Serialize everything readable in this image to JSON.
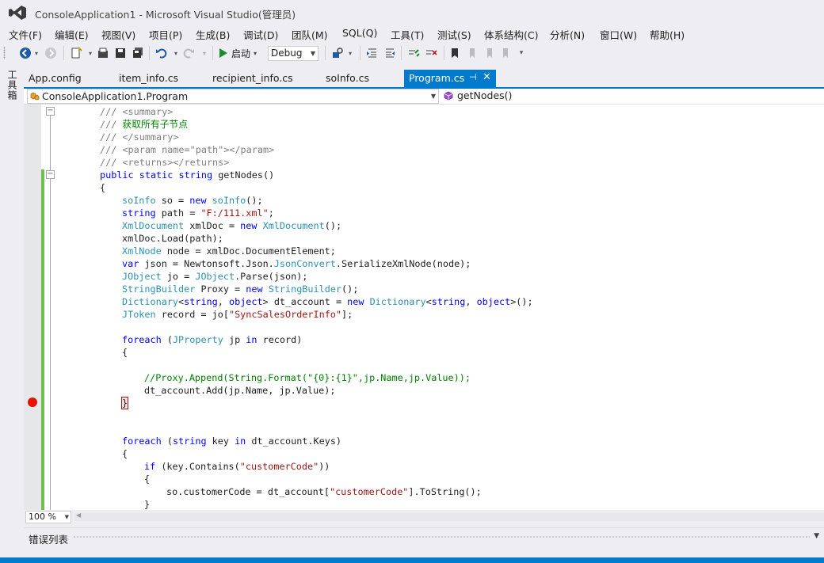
{
  "window": {
    "title": "ConsoleApplication1 - Microsoft Visual Studio(管理员)"
  },
  "menu": [
    {
      "label": "文件(F)",
      "name": "menu-file"
    },
    {
      "label": "编辑(E)",
      "name": "menu-edit"
    },
    {
      "label": "视图(V)",
      "name": "menu-view"
    },
    {
      "label": "项目(P)",
      "name": "menu-project"
    },
    {
      "label": "生成(B)",
      "name": "menu-build"
    },
    {
      "label": "调试(D)",
      "name": "menu-debug"
    },
    {
      "label": "团队(M)",
      "name": "menu-team"
    },
    {
      "label": "SQL(Q)",
      "name": "menu-sql"
    },
    {
      "label": "工具(T)",
      "name": "menu-tools"
    },
    {
      "label": "测试(S)",
      "name": "menu-test"
    },
    {
      "label": "体系结构(C)",
      "name": "menu-architecture"
    },
    {
      "label": "分析(N)",
      "name": "menu-analyze"
    },
    {
      "label": "窗口(W)",
      "name": "menu-window"
    },
    {
      "label": "帮助(H)",
      "name": "menu-help"
    }
  ],
  "toolbar": {
    "start_label": "启动",
    "config_value": "Debug"
  },
  "toolbox": {
    "label": "工具箱"
  },
  "tabs": [
    {
      "label": "App.config",
      "active": false
    },
    {
      "label": "item_info.cs",
      "active": false
    },
    {
      "label": "recipient_info.cs",
      "active": false
    },
    {
      "label": "soInfo.cs",
      "active": false
    },
    {
      "label": "Program.cs",
      "active": true
    }
  ],
  "navbar": {
    "class_value": "ConsoleApplication1.Program",
    "member_value": "getNodes()"
  },
  "code_lines": [
    "/// <summary>",
    "/// 获取所有子节点",
    "/// </summary>",
    "/// <param name=\"path\"></param>",
    "/// <returns></returns>",
    "public static string getNodes()",
    "{",
    "soInfo so = new soInfo();",
    "string path = \"F:/111.xml\";",
    "XmlDocument xmlDoc = new XmlDocument();",
    "xmlDoc.Load(path);",
    "XmlNode node = xmlDoc.DocumentElement;",
    "var json = Newtonsoft.Json.JsonConvert.SerializeXmlNode(node);",
    "JObject jo = JObject.Parse(json);",
    "StringBuilder Proxy = new StringBuilder();",
    "Dictionary<string, object> dt_account = new Dictionary<string, object>();",
    "JToken record = jo[\"SyncSalesOrderInfo\"];",
    "",
    "foreach (JProperty jp in record)",
    "{",
    "",
    "//Proxy.Append(String.Format(\"{0}:{1}\",jp.Name,jp.Value));",
    "dt_account.Add(jp.Name, jp.Value);",
    "}",
    "",
    "",
    "foreach (string key in dt_account.Keys)",
    "{",
    "if (key.Contains(\"customerCode\"))",
    "{",
    "so.customerCode = dt_account[\"customerCode\"].ToString();",
    "}"
  ],
  "status": {
    "zoom": "100 %"
  },
  "error_list": {
    "title": "错误列表"
  },
  "colors": {
    "accent": "#007acc",
    "keyword": "#0000ff",
    "type": "#2b91af",
    "string": "#a31515",
    "comment": "#008000",
    "doc_comment": "#808080",
    "breakpoint": "#e51400",
    "change_bar": "#6cc24a"
  }
}
